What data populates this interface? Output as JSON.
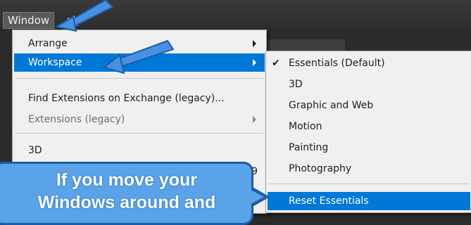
{
  "menubar": {
    "items": [
      {
        "label": "Window"
      },
      {
        "label": "Help",
        "visible_label": "elp"
      }
    ]
  },
  "window_menu": {
    "items": [
      {
        "label": "Arrange",
        "submenu": true
      },
      {
        "label": "Workspace",
        "submenu": true,
        "highlighted": true
      },
      {
        "label": "Find Extensions on Exchange (legacy)..."
      },
      {
        "label": "Extensions (legacy)",
        "submenu": true,
        "disabled": true
      },
      {
        "label": "3D"
      },
      {
        "partial_shortcut": "F9"
      }
    ]
  },
  "workspace_submenu": {
    "items": [
      {
        "label": "Essentials (Default)",
        "checked": true,
        "check_glyph": "✔"
      },
      {
        "label": "3D"
      },
      {
        "label": "Graphic and Web"
      },
      {
        "label": "Motion"
      },
      {
        "label": "Painting"
      },
      {
        "label": "Photography"
      },
      {
        "label": "Reset Essentials",
        "highlighted": true
      }
    ]
  },
  "callout": {
    "line1": "If you move your",
    "line2": "Windows around and"
  },
  "colors": {
    "menu_bg": "#f0f0f0",
    "highlight": "#0078d7",
    "callout_fill": "#5aa3e8",
    "callout_border": "#1a5da8",
    "menubar_bg": "#2d2d2d"
  }
}
